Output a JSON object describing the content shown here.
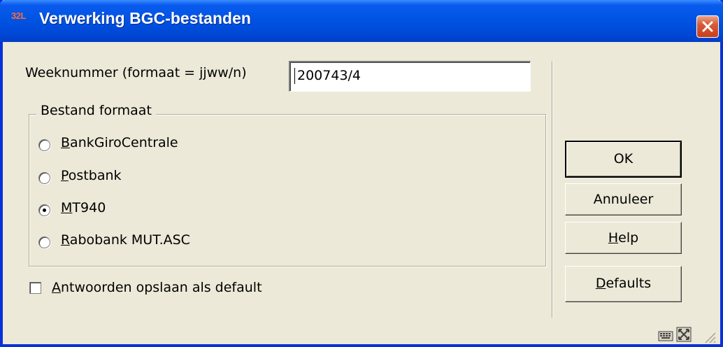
{
  "titlebar": {
    "app_icon_text": "32L",
    "title": "Verwerking BGC-bestanden",
    "close_icon": "close-icon"
  },
  "week": {
    "label": "Weeknummer (formaat = jjww/n)",
    "value": "200743/4"
  },
  "format_group": {
    "legend": "Bestand formaat",
    "options": [
      {
        "accel": "B",
        "rest": "ankGiroCentrale",
        "selected": false
      },
      {
        "accel": "P",
        "rest": "ostbank",
        "selected": false
      },
      {
        "accel": "M",
        "rest": "T940",
        "selected": true
      },
      {
        "accel": "R",
        "rest": "abobank MUT.ASC",
        "selected": false
      }
    ]
  },
  "save_default": {
    "accel": "A",
    "rest": "ntwoorden opslaan als default",
    "checked": false
  },
  "buttons": {
    "ok": "OK",
    "annuleer": "Annuleer",
    "help_accel": "H",
    "help_rest": "elp",
    "defaults_accel": "D",
    "defaults_rest": "efaults"
  },
  "status_icons": [
    "keyboard-icon",
    "resize-icon"
  ],
  "colors": {
    "titlebar": "#0054e3",
    "dialog_bg": "#ece9d8",
    "close_button": "#d85a36"
  }
}
